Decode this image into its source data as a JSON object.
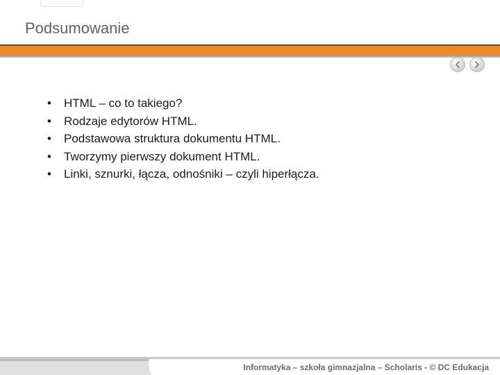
{
  "title": "Podsumowanie",
  "bullets": [
    "HTML – co to takiego?",
    "Rodzaje edytorów HTML.",
    "Podstawowa struktura dokumentu HTML.",
    "Tworzymy pierwszy dokument HTML.",
    "Linki, sznurki, łącza, odnośniki – czyli hiperłącza."
  ],
  "footer": "Informatyka – szkoła gimnazjalna – Scholaris - © DC Edukacja",
  "colors": {
    "accent": "#ed8824",
    "title": "#5f5f5f",
    "footer_text": "#6b6b6b"
  }
}
